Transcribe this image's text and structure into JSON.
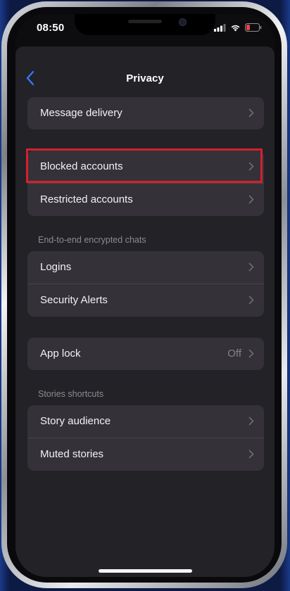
{
  "status_bar": {
    "time": "08:50"
  },
  "header": {
    "title": "Privacy"
  },
  "groups": [
    {
      "rows": [
        {
          "label": "Message delivery"
        }
      ]
    },
    {
      "rows": [
        {
          "label": "Blocked accounts",
          "highlighted": true
        },
        {
          "label": "Restricted accounts"
        }
      ]
    },
    {
      "section_label": "End-to-end encrypted chats",
      "rows": [
        {
          "label": "Logins"
        },
        {
          "label": "Security Alerts"
        }
      ]
    },
    {
      "rows": [
        {
          "label": "App lock",
          "value": "Off"
        }
      ]
    },
    {
      "section_label": "Stories shortcuts",
      "rows": [
        {
          "label": "Story audience"
        },
        {
          "label": "Muted stories"
        }
      ]
    }
  ],
  "colors": {
    "accent": "#3478f6",
    "highlight_border": "#d4202f",
    "background": "#232227",
    "row_background": "#343238"
  },
  "icons": {
    "back": "chevron-left-icon",
    "row_chevron": "chevron-right-icon",
    "signal": "cellular-signal-icon",
    "wifi": "wifi-icon",
    "battery": "battery-low-icon"
  }
}
